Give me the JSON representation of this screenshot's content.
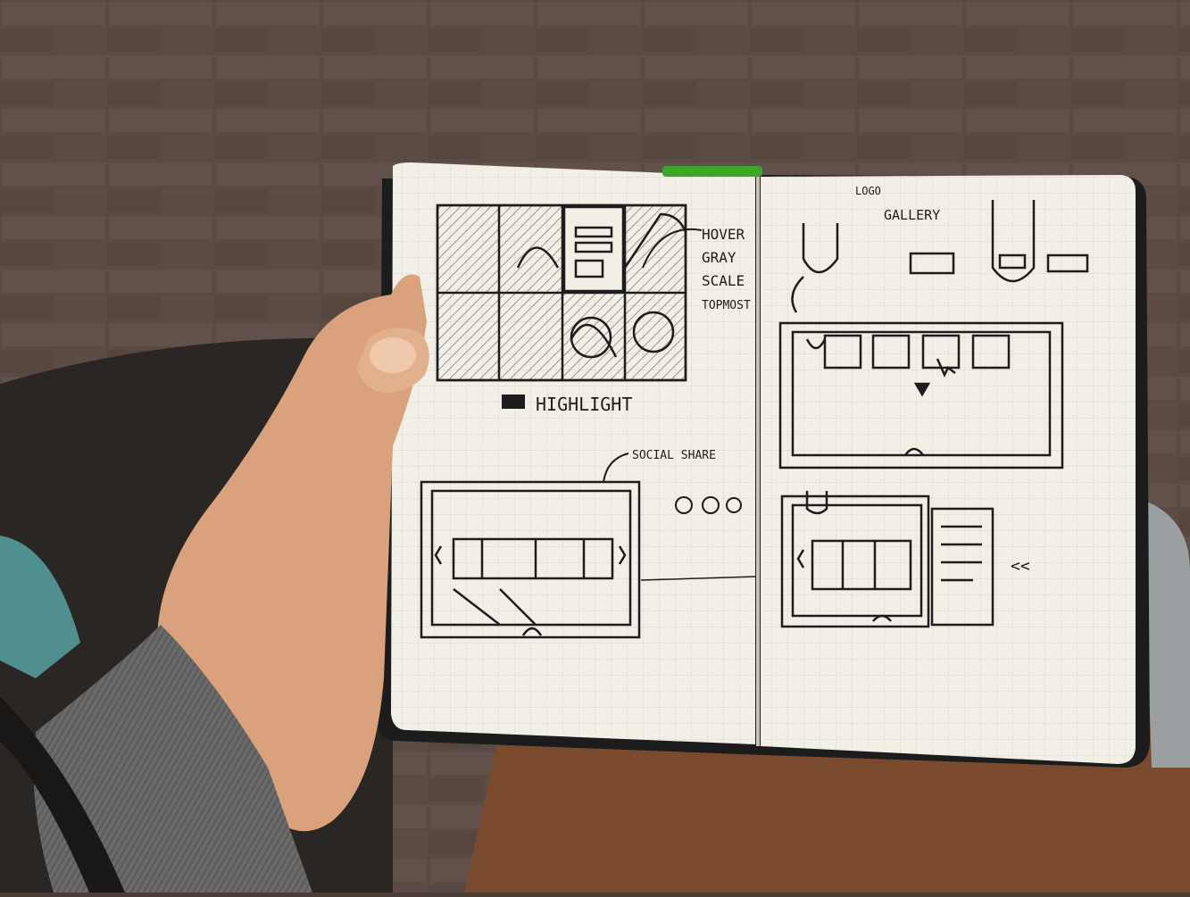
{
  "scene": {
    "description_free": true,
    "background": "brick-pavement",
    "subject": "open-grid-notebook-held-in-hand"
  },
  "colors": {
    "brick": "#5a4a43",
    "mortar": "#3a302c",
    "paper": "#f2efe6",
    "grid": "#b9b6ae",
    "ink": "#1d1d1d",
    "ribbon": "#3aa62a",
    "sleeve": "#6d6d6d",
    "skin": "#d9a27d",
    "trousers": "#7a4a2e"
  },
  "sketch": {
    "left_page": {
      "hover_note_lines": [
        "HOVER",
        "GRAY",
        "SCALE",
        "TOPMOST"
      ],
      "highlight_label": "HIGHLIGHT",
      "social_label": "SOCIAL SHARE"
    },
    "right_page": {
      "logo_label": "LOGO",
      "gallery_label": "GALLERY",
      "collapse_mark": "<<"
    }
  }
}
